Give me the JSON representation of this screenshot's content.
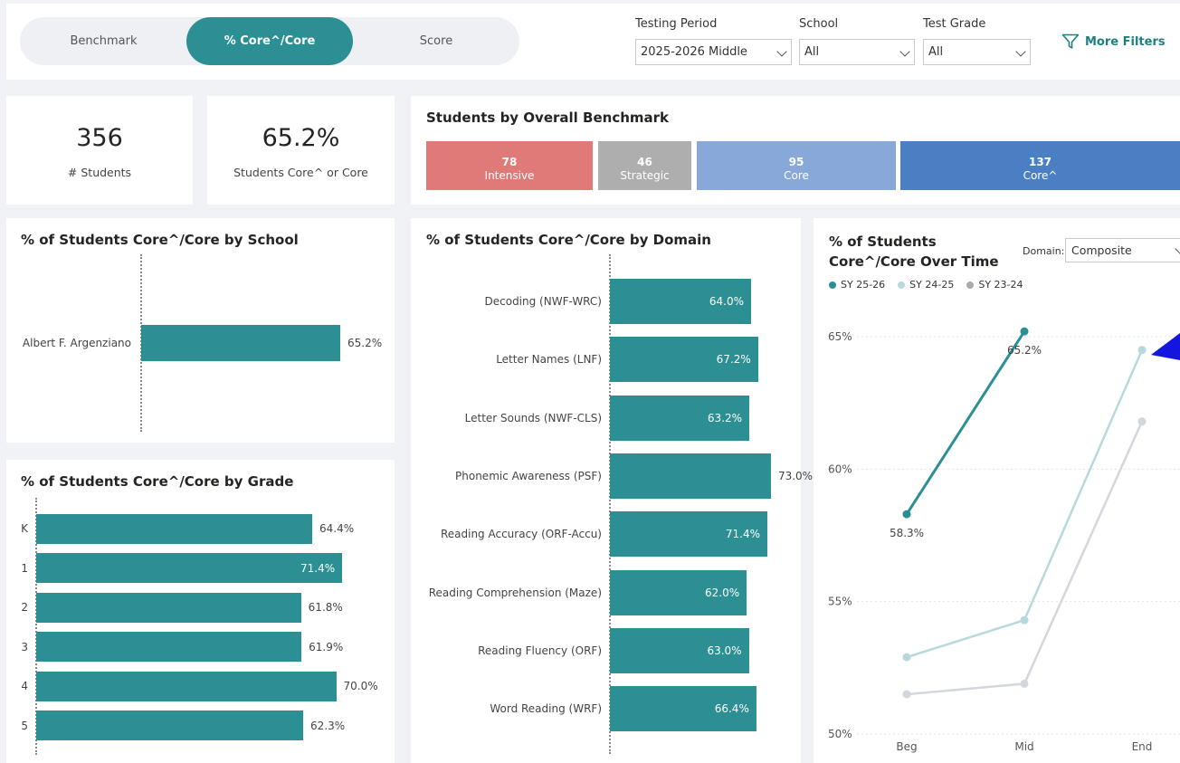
{
  "tabs": [
    {
      "label": "Benchmark",
      "active": false
    },
    {
      "label": "% Core^/Core",
      "active": true
    },
    {
      "label": "Score",
      "active": false
    }
  ],
  "filters": {
    "testing_period": {
      "label": "Testing Period",
      "value": "2025-2026 Middle"
    },
    "school": {
      "label": "School",
      "value": "All"
    },
    "test_grade": {
      "label": "Test Grade",
      "value": "All"
    },
    "more_filters": "More Filters"
  },
  "kpis": {
    "students": {
      "value": "356",
      "label": "# Students"
    },
    "core": {
      "value": "65.2%",
      "label": "Students Core^ or Core"
    }
  },
  "colors": {
    "teal": "#2b8f94",
    "intensive": "#e07a78",
    "strategic": "#aeaeae",
    "core": "#87a8d8",
    "core_plus": "#4a7fc4",
    "sy2425": "#b7d8dd",
    "sy2324": "#d3d6db"
  },
  "benchmark": {
    "title": "Students by Overall Benchmark",
    "segments": [
      {
        "count": "78",
        "label": "Intensive",
        "value": 78
      },
      {
        "count": "46",
        "label": "Strategic",
        "value": 46
      },
      {
        "count": "95",
        "label": "Core",
        "value": 95
      },
      {
        "count": "137",
        "label": "Core^",
        "value": 137
      }
    ]
  },
  "school_chart": {
    "title": "% of Students Core^/Core by School",
    "chart_data": {
      "type": "bar",
      "orientation": "horizontal",
      "categories": [
        "Albert F. Argenziano"
      ],
      "values": [
        65.2
      ],
      "labels": [
        "65.2%"
      ]
    }
  },
  "grade_chart": {
    "title": "% of Students Core^/Core by Grade",
    "chart_data": {
      "type": "bar",
      "orientation": "horizontal",
      "categories": [
        "K",
        "1",
        "2",
        "3",
        "4",
        "5"
      ],
      "values": [
        64.4,
        71.4,
        61.8,
        61.9,
        70.0,
        62.3
      ],
      "labels": [
        "64.4%",
        "71.4%",
        "61.8%",
        "61.9%",
        "70.0%",
        "62.3%"
      ]
    }
  },
  "domain_chart": {
    "title": "% of Students Core^/Core by Domain",
    "chart_data": {
      "type": "bar",
      "orientation": "horizontal",
      "categories": [
        "Decoding (NWF-WRC)",
        "Letter Names (LNF)",
        "Letter Sounds (NWF-CLS)",
        "Phonemic Awareness (PSF)",
        "Reading Accuracy (ORF-Accu)",
        "Reading Comprehension (Maze)",
        "Reading Fluency (ORF)",
        "Word Reading (WRF)"
      ],
      "values": [
        64.0,
        67.2,
        63.2,
        73.0,
        71.4,
        62.0,
        63.0,
        66.4
      ],
      "labels": [
        "64.0%",
        "67.2%",
        "63.2%",
        "73.0%",
        "71.4%",
        "62.0%",
        "63.0%",
        "66.4%"
      ]
    }
  },
  "time_chart": {
    "title_line1": "% of Students",
    "title_line2": "Core^/Core Over Time",
    "domain_label": "Domain:",
    "domain_value": "Composite",
    "chart_data": {
      "type": "line",
      "x": [
        "Beg",
        "Mid",
        "End"
      ],
      "ylim": [
        50,
        65
      ],
      "yticks": [
        "65%",
        "60%",
        "55%",
        "50%"
      ],
      "ytick_values": [
        65,
        60,
        55,
        50
      ],
      "series": [
        {
          "name": "SY 25-26",
          "values": [
            58.3,
            65.2,
            null
          ],
          "labels": [
            "58.3%",
            "65.2%",
            ""
          ]
        },
        {
          "name": "SY 24-25",
          "values": [
            52.9,
            54.3,
            64.5
          ]
        },
        {
          "name": "SY 23-24",
          "values": [
            51.5,
            51.9,
            61.8
          ]
        }
      ]
    }
  }
}
